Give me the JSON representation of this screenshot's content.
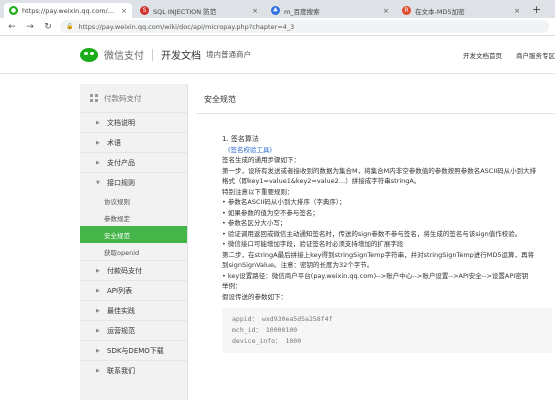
{
  "browser": {
    "tabs": [
      {
        "title": "https://pay.weixin.qq.com/wik",
        "fav_color": "#1aad19",
        "fav_glyph": "●",
        "active": true
      },
      {
        "title": "SQL INJECTION 防范",
        "fav_color": "#d0302a",
        "fav_glyph": "S",
        "active": false
      },
      {
        "title": "m_百度搜索",
        "fav_color": "#2f6fe0",
        "fav_glyph": "♣",
        "active": false
      },
      {
        "title": "在文本-MD5加密",
        "fav_color": "#e04a2a",
        "fav_glyph": "R",
        "active": false
      }
    ],
    "new_tab": "+",
    "url": "https://pay.weixin.qq.com/wiki/doc/api/micropay.php?chapter=4_3",
    "icons": {
      "back": "arrow-left-icon",
      "forward": "arrow-right-icon",
      "reload": "reload-icon",
      "lock": "lock-icon"
    }
  },
  "header": {
    "logo_text": "微信支付",
    "doc_title": "开发文档",
    "doc_sub": "境内普通商户",
    "links": [
      "开发文档首页",
      "商户服务专区"
    ]
  },
  "sidebar": {
    "title": "付款码支付",
    "items_top": [
      {
        "label": "文档说明"
      },
      {
        "label": "术语"
      },
      {
        "label": "支付产品"
      },
      {
        "label": "接口规则"
      }
    ],
    "sub_items": [
      {
        "label": "协议规则",
        "active": false
      },
      {
        "label": "参数规定",
        "active": false
      },
      {
        "label": "安全规范",
        "active": true
      },
      {
        "label": "获取openid",
        "active": false
      }
    ],
    "items_bottom": [
      {
        "label": "付款码支付"
      },
      {
        "label": "API列表"
      },
      {
        "label": "最佳实践"
      },
      {
        "label": "运营规范"
      },
      {
        "label": "SDK与DEMO下载"
      },
      {
        "label": "联系我们"
      }
    ]
  },
  "content": {
    "section_title": "安全规范",
    "lines": [
      {
        "text": "1. 签名算法",
        "cls": "h1"
      },
      {
        "text": "(签名校验工具)",
        "cls": "link"
      },
      {
        "text": "签名生成的通用步骤如下：",
        "cls": ""
      },
      {
        "text": "第一步，设所有发送或者接收到的数据为集合M，将集合M内非空参数值的参数按照参数名ASCII码从小到大排",
        "cls": ""
      },
      {
        "text": "格式（即key1=value1&key2=value2…）拼接成字符串stringA。",
        "cls": ""
      },
      {
        "text": "特别注意以下重要规则：",
        "cls": ""
      },
      {
        "text": "• 参数名ASCII码从小到大排序（字典序）；",
        "cls": ""
      },
      {
        "text": "• 如果参数的值为空不参与签名；",
        "cls": ""
      },
      {
        "text": "• 参数名区分大小写；",
        "cls": ""
      },
      {
        "text": "• 验证调用返回或微信主动通知签名时，传送的sign参数不参与签名，将生成的签名与该sign值作校验。",
        "cls": ""
      },
      {
        "text": "• 微信接口可能增加字段，验证签名时必须支持增加的扩展字段",
        "cls": ""
      },
      {
        "text": "第二步，在stringA最后拼接上key得到stringSignTemp字符串，并对stringSignTemp进行MD5运算，再将",
        "cls": ""
      },
      {
        "text": "到signSignValue。注意：密钥的长度为32个字节。",
        "cls": ""
      },
      {
        "text": "• key设置路径：微信商户平台(pay.weixin.qq.com)-->账户中心-->账户设置-->API安全-->设置API密钥",
        "cls": ""
      },
      {
        "text": "举例：",
        "cls": ""
      },
      {
        "text": "假设传送的参数如下：",
        "cls": ""
      }
    ],
    "code_lines": [
      "appid： wxd930ea5d5a258f4f",
      "mch_id： 10000100",
      "device_info： 1000"
    ]
  }
}
